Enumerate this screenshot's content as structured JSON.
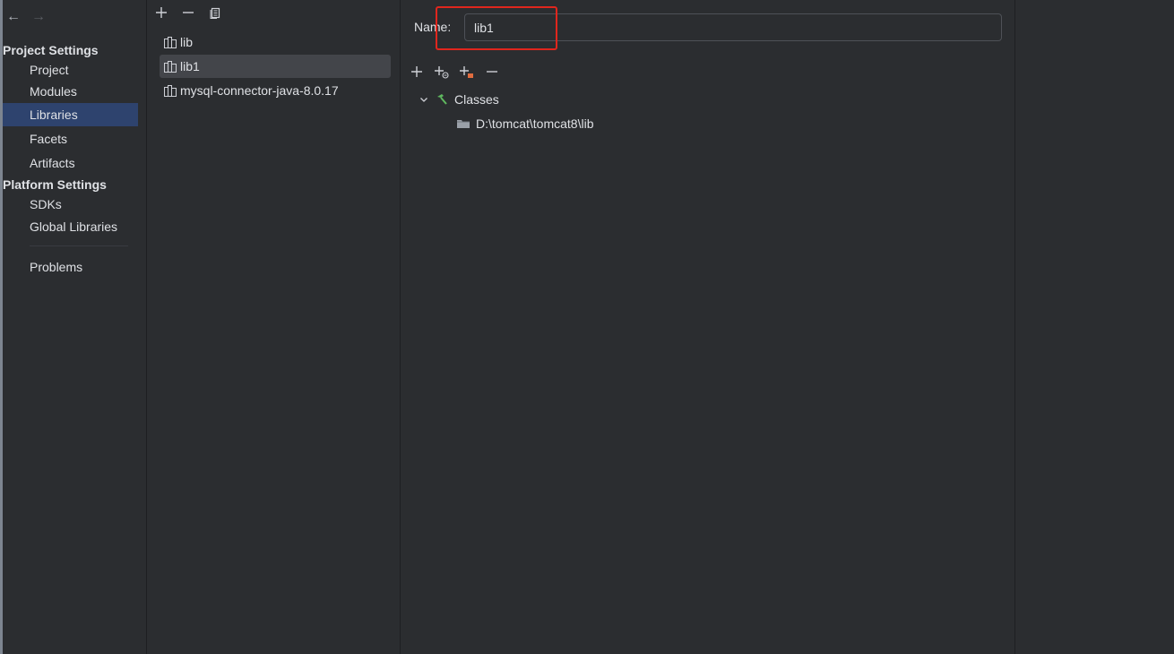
{
  "nav": {
    "back_icon": "arrow-left",
    "forward_icon": "arrow-right",
    "project_settings_header": "Project Settings",
    "project_items": [
      "Project",
      "Modules",
      "Libraries",
      "Facets",
      "Artifacts"
    ],
    "platform_settings_header": "Platform Settings",
    "platform_items": [
      "SDKs",
      "Global Libraries"
    ],
    "problems": "Problems",
    "selected": "Libraries"
  },
  "libraries": {
    "toolbar": [
      "add-icon",
      "remove-icon",
      "copy-icon"
    ],
    "items": [
      "lib",
      "lib1",
      "mysql-connector-java-8.0.17"
    ],
    "selected": "lib1"
  },
  "detail": {
    "name_label": "Name:",
    "name_value": "lib1",
    "toolbar": [
      "add-icon",
      "add-class-path-icon",
      "add-jar-icon",
      "remove-icon"
    ],
    "tree": {
      "root_label": "Classes",
      "children": [
        "D:\\tomcat\\tomcat8\\lib"
      ]
    }
  },
  "colors": {
    "background": "#2b2d30",
    "selection": "#2e436e",
    "highlight": "#e0261d",
    "accent_green": "#5fb85f"
  }
}
